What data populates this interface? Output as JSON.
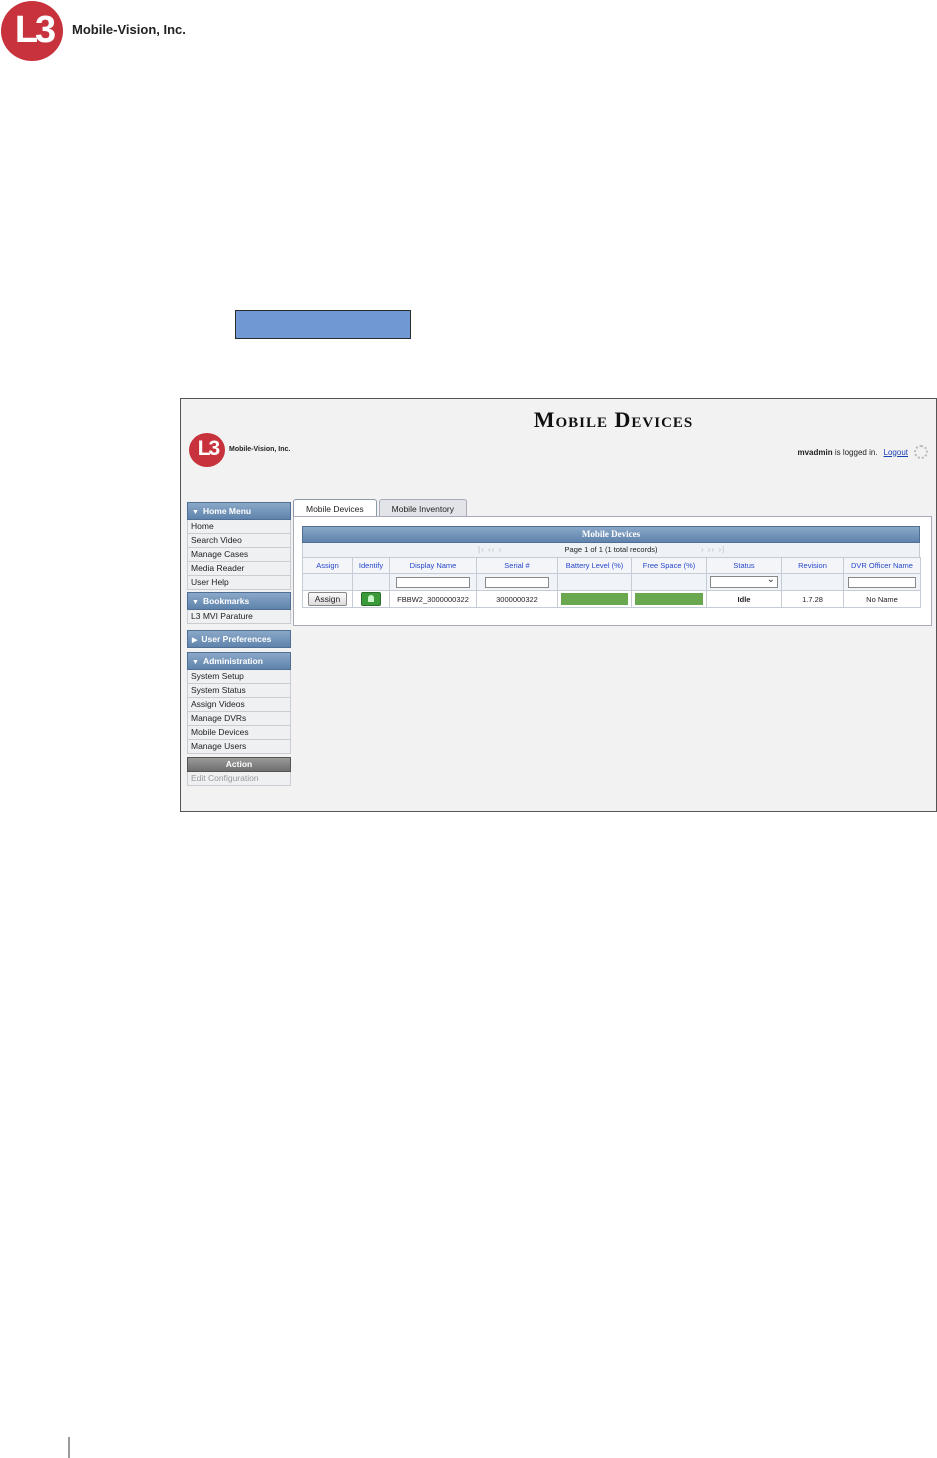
{
  "doc": {
    "logo_mark": "L3",
    "company": "Mobile-Vision, Inc."
  },
  "screenshot": {
    "title": "Mobile Devices",
    "logo_mark": "L3",
    "company": "Mobile-Vision, Inc.",
    "login": {
      "user": "mvadmin",
      "text": "is logged in.",
      "logout": "Logout"
    },
    "sidebar": {
      "home_menu": {
        "label": "Home Menu",
        "items": [
          "Home",
          "Search Video",
          "Manage Cases",
          "Media Reader",
          "User Help"
        ]
      },
      "bookmarks": {
        "label": "Bookmarks",
        "items": [
          "L3 MVI Parature"
        ]
      },
      "user_prefs": {
        "label": "User Preferences"
      },
      "administration": {
        "label": "Administration",
        "items": [
          "System Setup",
          "System Status",
          "Assign Videos",
          "Manage DVRs",
          "Mobile Devices",
          "Manage Users"
        ]
      },
      "action": {
        "label": "Action",
        "items": [
          "Edit Configuration"
        ]
      }
    },
    "tabs": [
      "Mobile Devices",
      "Mobile Inventory"
    ],
    "grid": {
      "title": "Mobile Devices",
      "pager": "Page 1 of 1 (1 total records)",
      "columns": [
        "Assign",
        "Identify",
        "Display Name",
        "Serial #",
        "Battery Level (%)",
        "Free Space (%)",
        "Status",
        "Revision",
        "DVR Officer Name"
      ],
      "row": {
        "assign_label": "Assign",
        "display_name": "FBBW2_3000000322",
        "serial": "3000000322",
        "battery_level": 100,
        "free_space": 100,
        "status": "Idle",
        "revision": "1.7.28",
        "officer": "No Name"
      }
    }
  }
}
